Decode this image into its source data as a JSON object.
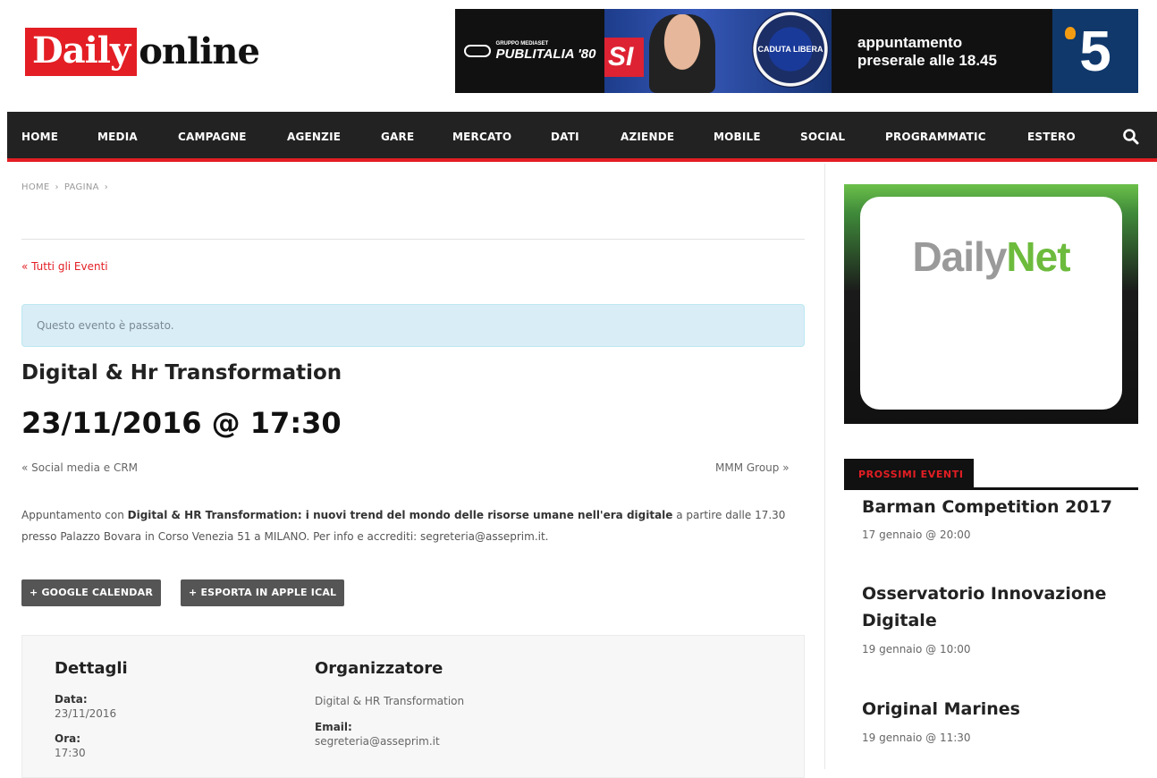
{
  "logo": {
    "part1": "Daily",
    "part2": "online"
  },
  "banner": {
    "publitalia_small": "GRUPPO MEDIASET",
    "publitalia": "PUBLITALIA '80",
    "si": "SI",
    "medal": "CADUTA LIBERA",
    "text_line1": "appuntamento",
    "text_line2": "preserale alle 18.45",
    "channel": "5"
  },
  "nav": {
    "items": [
      "HOME",
      "MEDIA",
      "CAMPAGNE",
      "AGENZIE",
      "GARE",
      "MERCATO",
      "DATI",
      "AZIENDE",
      "MOBILE",
      "SOCIAL",
      "PROGRAMMATIC",
      "ESTERO"
    ],
    "search_icon": "search-icon"
  },
  "breadcrumb": {
    "home": "HOME",
    "sep": "›",
    "page": "PAGINA"
  },
  "back_link": "« Tutti gli Eventi",
  "notice": "Questo evento è passato.",
  "event": {
    "title": "Digital & Hr Transformation",
    "datetime": "23/11/2016 @ 17:30",
    "prev": "« Social media e CRM",
    "next": "MMM Group »",
    "desc_intro": "Appuntamento con ",
    "desc_bold": "Digital & HR Transformation: i nuovi trend del mondo delle risorse umane nell'era digitale",
    "desc_rest": " a partire dalle 17.30 presso Palazzo Bovara in Corso Venezia 51 a MILANO. Per info e accrediti: segreteria@asseprim.it."
  },
  "buttons": {
    "google": "+ GOOGLE CALENDAR",
    "ical": "+ ESPORTA IN APPLE ICAL"
  },
  "details": {
    "heading": "Dettagli",
    "date_label": "Data:",
    "date_value": "23/11/2016",
    "time_label": "Ora:",
    "time_value": "17:30"
  },
  "organizer": {
    "heading": "Organizzatore",
    "name": "Digital & HR Transformation",
    "email_label": "Email:",
    "email_value": "segreteria@asseprim.it"
  },
  "sidebar": {
    "ad": {
      "part1": "Daily",
      "part2": "Net"
    },
    "upcoming_label": "PROSSIMI EVENTI",
    "events": [
      {
        "title": "Barman Competition 2017",
        "date": "17 gennaio @ 20:00"
      },
      {
        "title_line1": "Osservatorio Innovazione",
        "title_line2": "Digitale",
        "date": "19 gennaio @ 10:00"
      },
      {
        "title": "Original Marines",
        "date": "19 gennaio @ 11:30"
      }
    ]
  },
  "colors": {
    "accent": "#e31e24",
    "nav_bg": "#222222",
    "notice_bg": "#d9edf7",
    "button_bg": "#555555"
  }
}
